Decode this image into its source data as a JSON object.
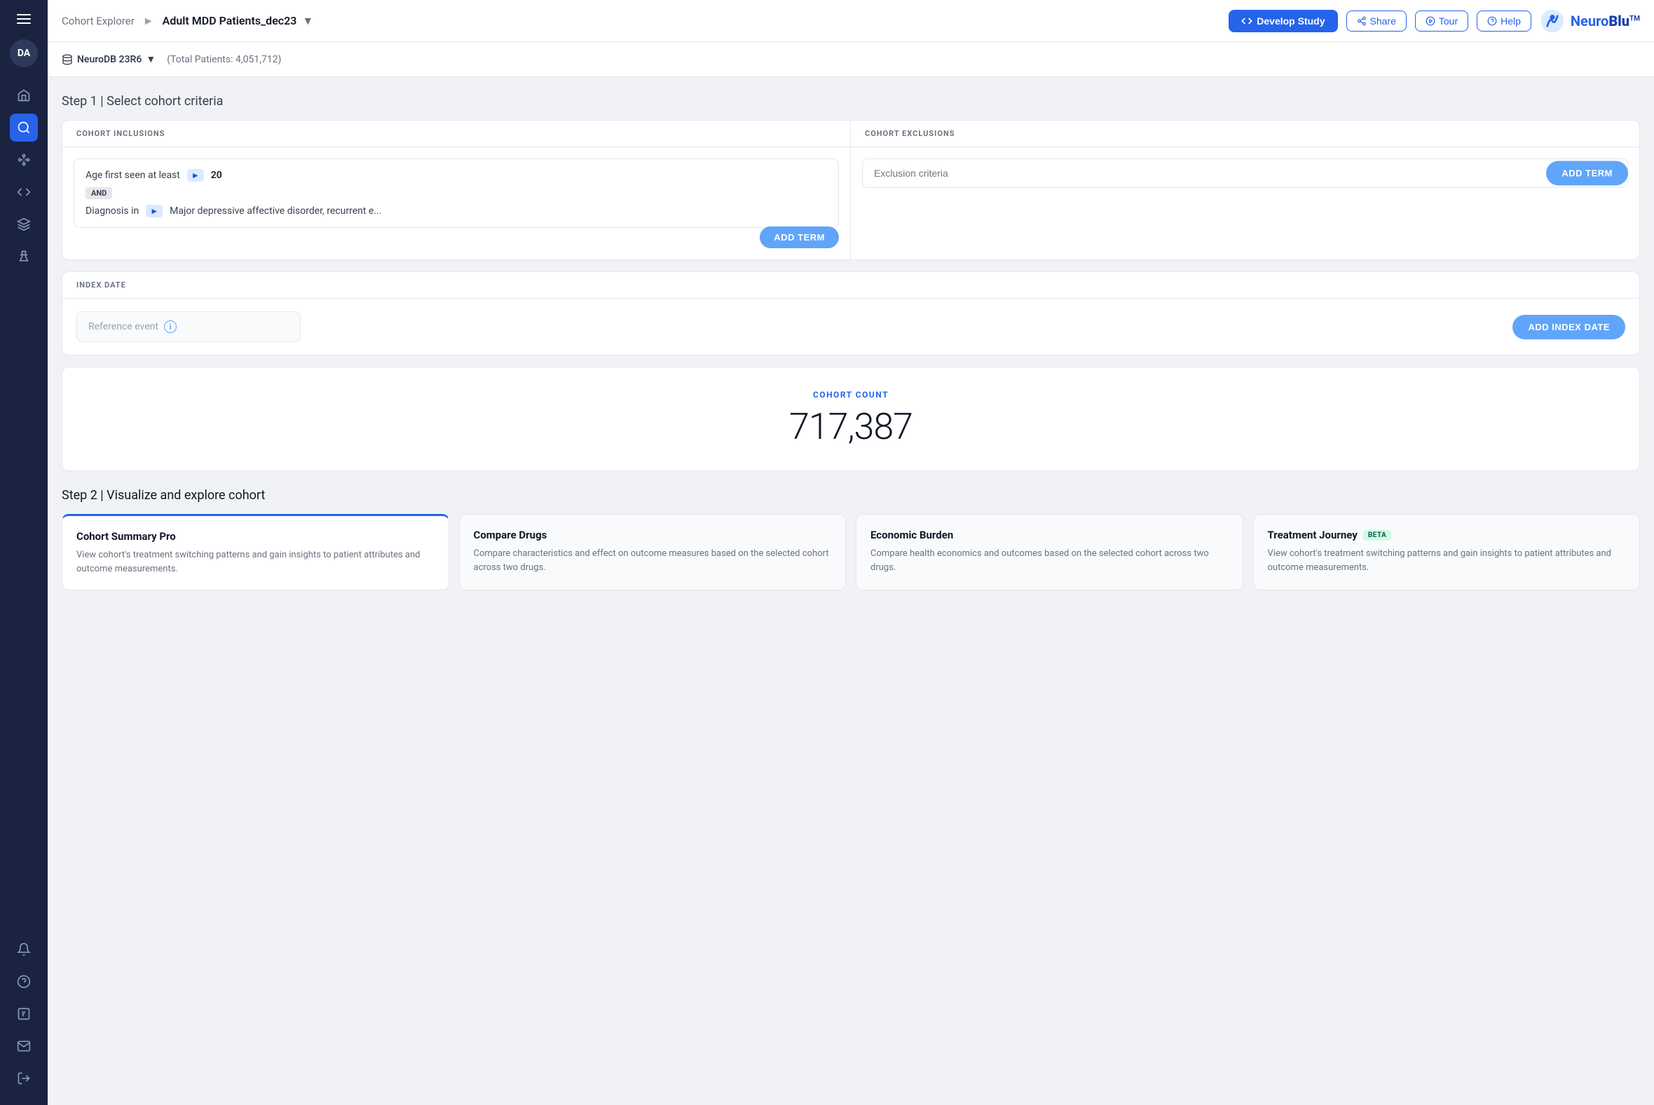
{
  "sidebar": {
    "avatar": "DA",
    "icons": [
      {
        "name": "home-icon",
        "label": "Home"
      },
      {
        "name": "cohort-icon",
        "label": "Cohort",
        "active": true
      },
      {
        "name": "pipeline-icon",
        "label": "Pipeline"
      },
      {
        "name": "code-icon",
        "label": "Code"
      },
      {
        "name": "layers-icon",
        "label": "Layers"
      },
      {
        "name": "flask-icon",
        "label": "Flask"
      }
    ],
    "bottom_icons": [
      {
        "name": "bell-icon",
        "label": "Notifications"
      },
      {
        "name": "help-circle-icon",
        "label": "Help"
      },
      {
        "name": "question-icon",
        "label": "Question"
      },
      {
        "name": "mail-icon",
        "label": "Mail"
      },
      {
        "name": "logout-icon",
        "label": "Logout"
      }
    ]
  },
  "topbar": {
    "breadcrumb": "Cohort Explorer",
    "title": "Adult MDD Patients_dec23",
    "develop_label": "Develop Study",
    "share_label": "Share",
    "tour_label": "Tour",
    "help_label": "Help",
    "logo_neuro": "Neuro",
    "logo_blu": "Blu"
  },
  "subbar": {
    "db_name": "NeuroDB 23R6",
    "total_patients_label": "(Total Patients: 4,051,712)"
  },
  "step1": {
    "heading": "Step 1",
    "heading_suffix": " | Select cohort criteria",
    "inclusions_header": "COHORT INCLUSIONS",
    "exclusions_header": "COHORT EXCLUSIONS",
    "inclusion_term1_label": "Age first seen at least",
    "inclusion_term1_value": "20",
    "and_label": "AND",
    "inclusion_term2_label": "Diagnosis in",
    "inclusion_term2_value": "Major depressive affective disorder, recurrent e...",
    "add_term_label": "ADD TERM",
    "exclusion_placeholder": "Exclusion criteria",
    "add_term_exclusion_label": "ADD TERM",
    "index_header": "INDEX DATE",
    "ref_event_placeholder": "Reference event",
    "add_index_label": "ADD INDEX DATE"
  },
  "cohort_count": {
    "label": "COHORT COUNT",
    "value": "717,387"
  },
  "step2": {
    "heading": "Step 2",
    "heading_suffix": " | Visualize and explore cohort",
    "cards": [
      {
        "title": "Cohort Summary Pro",
        "desc": "View cohort's treatment switching patterns and gain insights to patient attributes and outcome measurements.",
        "active": true,
        "beta": false
      },
      {
        "title": "Compare Drugs",
        "desc": "Compare characteristics and effect on outcome measures based on the selected cohort across two drugs.",
        "active": false,
        "beta": false
      },
      {
        "title": "Economic Burden",
        "desc": "Compare health economics and outcomes based on the selected cohort across two drugs.",
        "active": false,
        "beta": false
      },
      {
        "title": "Treatment Journey",
        "desc": "View cohort's treatment switching patterns and gain insights to patient attributes and outcome measurements.",
        "active": false,
        "beta": true
      }
    ]
  }
}
